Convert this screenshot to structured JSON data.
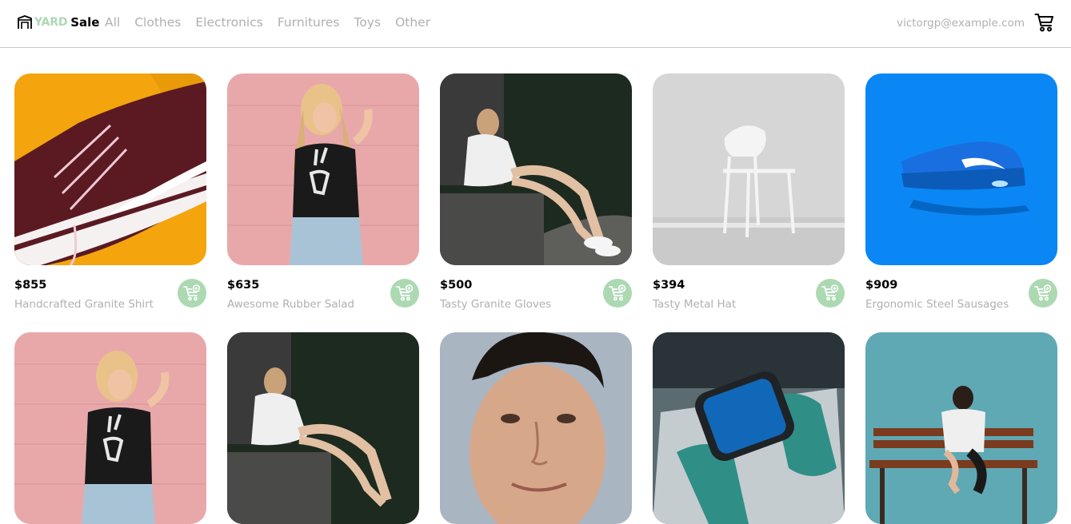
{
  "brand": {
    "accent": "YARD",
    "name": "Sale",
    "accent_color": "#acd9b2"
  },
  "nav": {
    "categories": [
      "All",
      "Clothes",
      "Electronics",
      "Furnitures",
      "Toys",
      "Other"
    ],
    "account_email": "victorgp@example.com",
    "cart_icon": "shopping-cart-icon"
  },
  "products": [
    {
      "price": "$855",
      "name": "Handcrafted Granite Shirt",
      "image": "maroon-sneaker-on-yellow"
    },
    {
      "price": "$635",
      "name": "Awesome Rubber Salad",
      "image": "woman-skeleton-tshirt-pink-wall"
    },
    {
      "price": "$500",
      "name": "Tasty Granite Gloves",
      "image": "woman-sitting-on-stone-block"
    },
    {
      "price": "$394",
      "name": "Tasty Metal Hat",
      "image": "white-chair-grey-room"
    },
    {
      "price": "$909",
      "name": "Ergonomic Steel Sausages",
      "image": "blue-sneaker-on-blue"
    },
    {
      "image": "woman-skeleton-tshirt-pink-wall"
    },
    {
      "image": "woman-sitting-on-stone-block"
    },
    {
      "image": "man-portrait-closeup"
    },
    {
      "image": "smartwatch-green-strap"
    },
    {
      "image": "woman-on-wooden-bench-teal-wall"
    }
  ],
  "add_to_cart_icon": "cart-plus-icon"
}
